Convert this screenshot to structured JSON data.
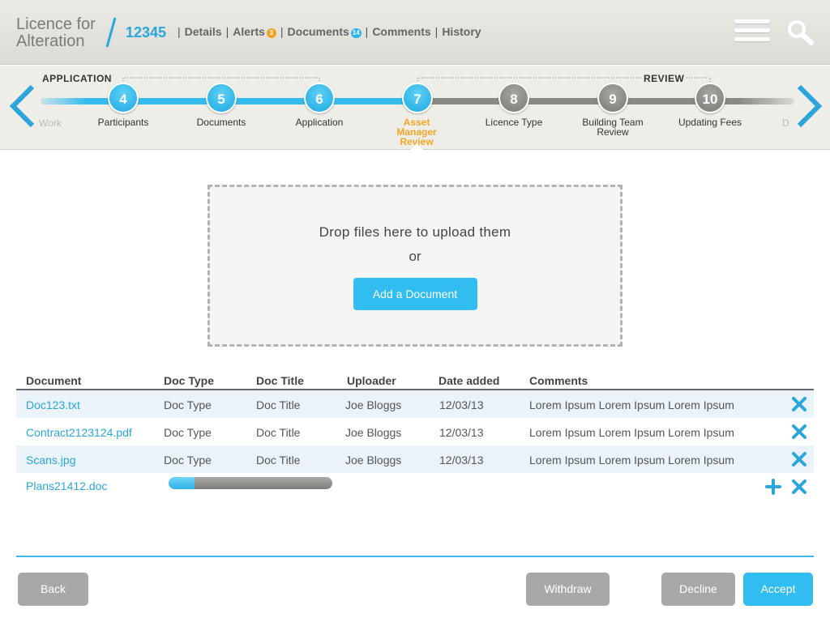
{
  "header": {
    "title_line1": "Licence for",
    "title_line2": "Alteration",
    "case_number": "12345",
    "nav": [
      {
        "label": "Details",
        "badge": null
      },
      {
        "label": "Alerts",
        "badge": "3"
      },
      {
        "label": "Documents",
        "badge": "14"
      },
      {
        "label": "Comments",
        "badge": null
      },
      {
        "label": "History",
        "badge": null
      }
    ],
    "separator": "|"
  },
  "stepper": {
    "phase_application": "APPLICATION",
    "phase_review": "REVIEW",
    "prev_faded": "Work",
    "next_faded": "D",
    "steps": [
      {
        "number": "4",
        "label": "Participants",
        "state": "done"
      },
      {
        "number": "5",
        "label": "Documents",
        "state": "done"
      },
      {
        "number": "6",
        "label": "Application",
        "state": "done"
      },
      {
        "number": "7",
        "label": "Asset Manager Review",
        "state": "active"
      },
      {
        "number": "8",
        "label": "Licence Type",
        "state": "todo"
      },
      {
        "number": "9",
        "label": "Building Team Review",
        "state": "todo"
      },
      {
        "number": "10",
        "label": "Updating Fees",
        "state": "todo"
      }
    ]
  },
  "upload": {
    "drop_text": "Drop files here to upload them",
    "or_text": "or",
    "add_button": "Add a Document"
  },
  "table": {
    "headers": [
      "Document",
      "Doc Type",
      "Doc Title",
      "Uploader",
      "Date added",
      "Comments"
    ],
    "rows": [
      {
        "document": "Doc123.txt",
        "doc_type": "Doc Type",
        "doc_title": "Doc Title",
        "uploader": "Joe Bloggs",
        "date": "12/03/13",
        "comments": "Lorem Ipsum Lorem Ipsum Lorem Ipsum"
      },
      {
        "document": "Contract2123124.pdf",
        "doc_type": "Doc Type",
        "doc_title": "Doc Title",
        "uploader": "Joe Bloggs",
        "date": "12/03/13",
        "comments": "Lorem Ipsum Lorem Ipsum Lorem Ipsum"
      },
      {
        "document": "Scans.jpg",
        "doc_type": "Doc Type",
        "doc_title": "Doc Title",
        "uploader": "Joe Bloggs",
        "date": "12/03/13",
        "comments": "Lorem Ipsum Lorem Ipsum Lorem Ipsum"
      }
    ],
    "uploading": {
      "document": "Plans21412.doc",
      "progress": 0.16
    }
  },
  "footer": {
    "back": "Back",
    "withdraw": "Withdraw",
    "decline": "Decline",
    "accept": "Accept"
  },
  "colors": {
    "accent": "#2aa6dc",
    "active_step": "#f5a623",
    "badge_orange": "#f1a420",
    "grey_button": "#a8a8a8"
  },
  "icons": [
    "menu-icon",
    "search-icon",
    "chevron-left-icon",
    "chevron-right-icon",
    "close-icon",
    "plus-icon"
  ]
}
